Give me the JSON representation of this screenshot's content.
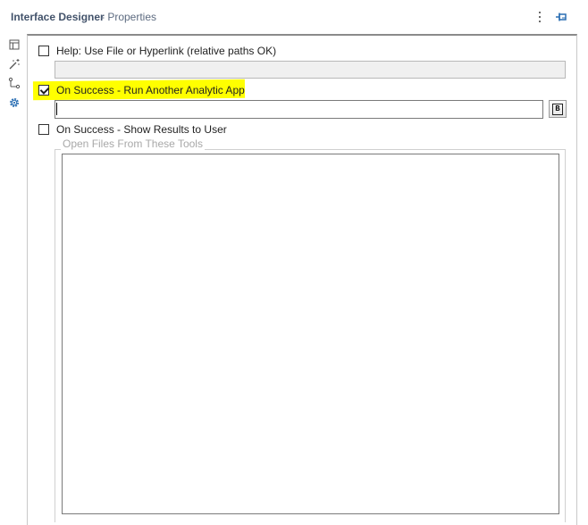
{
  "header": {
    "title": "Interface Designer",
    "subtitle": "- Properties",
    "menu_icon": "kebab-menu-icon",
    "pin_icon": "pin-icon"
  },
  "sidebar": {
    "items": [
      {
        "name": "layout",
        "icon": "layout-icon"
      },
      {
        "name": "magic",
        "icon": "magic-wand-icon"
      },
      {
        "name": "tree",
        "icon": "tree-icon"
      },
      {
        "name": "properties",
        "icon": "gear-icon",
        "active": true
      }
    ]
  },
  "properties": {
    "help_checkbox": {
      "label": "Help: Use File or Hyperlink (relative paths OK)",
      "checked": false
    },
    "help_field": {
      "value": "",
      "disabled": true
    },
    "run_app_checkbox": {
      "label": "On Success - Run Another Analytic App",
      "checked": true
    },
    "run_app_field": {
      "value": ""
    },
    "browse_button": {
      "label": "B"
    },
    "show_results_checkbox": {
      "label": "On Success - Show Results to User",
      "checked": false
    },
    "open_files_group": {
      "label": "Open Files From These Tools",
      "items": []
    }
  },
  "colors": {
    "highlight": "#ffff00",
    "active_icon": "#2b6fb3",
    "title": "#43536b"
  }
}
